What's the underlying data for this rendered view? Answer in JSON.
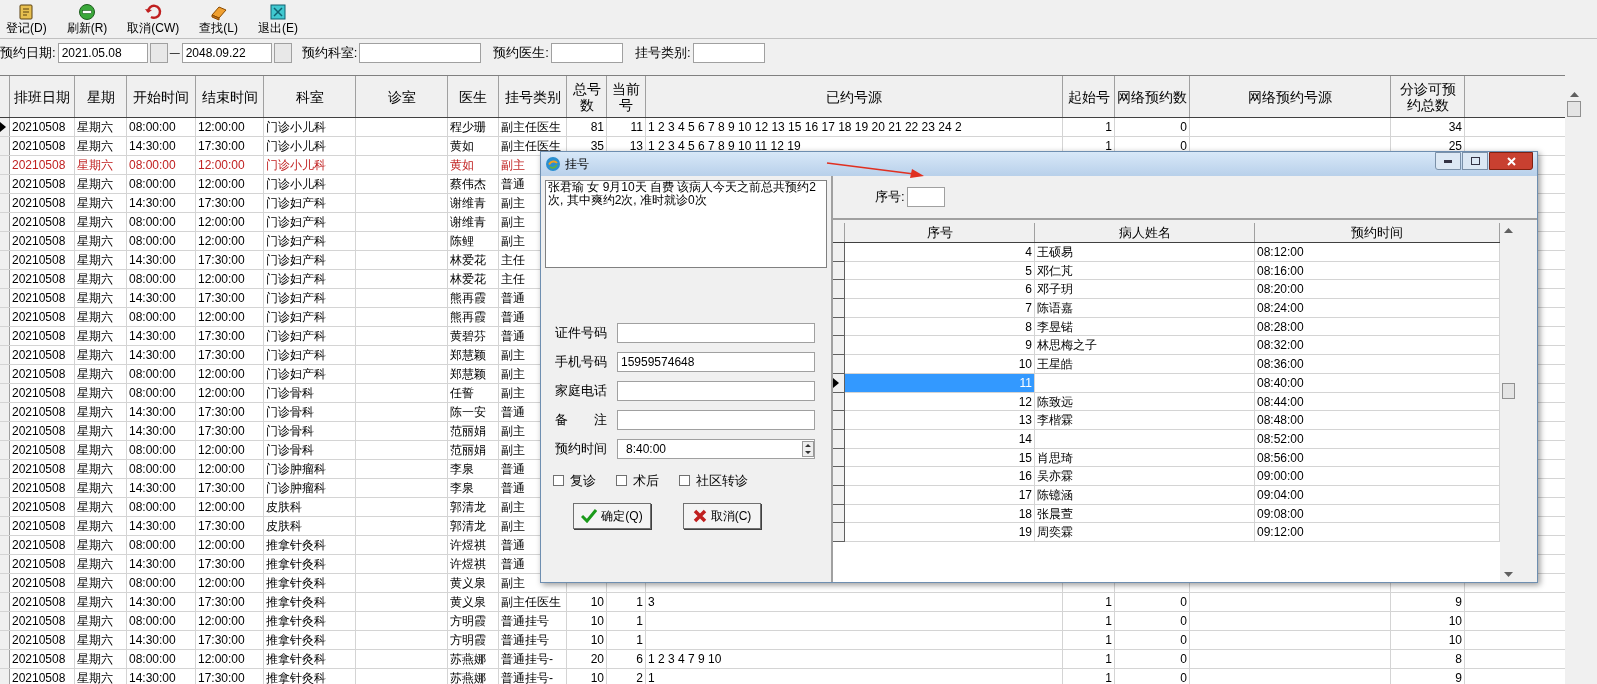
{
  "toolbar": [
    {
      "label": "登记(D)"
    },
    {
      "label": "刷新(R)"
    },
    {
      "label": "取消(CW)"
    },
    {
      "label": "查找(L)"
    },
    {
      "label": "退出(E)"
    }
  ],
  "filters": {
    "date_label": "预约日期:",
    "date_from": "2021.05.08",
    "date_sep": "—",
    "date_to": "2048.09.22",
    "dept_label": "预约科室:",
    "doctor_label": "预约医生:",
    "category_label": "挂号类别:"
  },
  "table": {
    "columns": [
      "排班日期",
      "星期",
      "开始时间",
      "结束时间",
      "科室",
      "诊室",
      "医生",
      "挂号类别",
      "总号数",
      "当前号",
      "已约号源",
      "起始号",
      "网络预约数",
      "网络预约号源",
      "分诊可预约总数"
    ],
    "rows": [
      {
        "current": true,
        "highlighted": false,
        "date": "20210508",
        "weekday": "星期六",
        "start": "08:00:00",
        "end": "12:00:00",
        "dept": "门诊小儿科",
        "doctor": "程少珊",
        "category": "副主任医生",
        "total": "81",
        "current_no": "11",
        "booked": "1 2 3 4 5 6 7 8 9 10 12 13 15 16 17 18 19 20 21 22 23 24 2",
        "start_no": "1",
        "net_count": "0",
        "triage_total": "34"
      },
      {
        "current": false,
        "highlighted": false,
        "date": "20210508",
        "weekday": "星期六",
        "start": "14:30:00",
        "end": "17:30:00",
        "dept": "门诊小儿科",
        "doctor": "黄如",
        "category": "副主任医生",
        "total": "35",
        "current_no": "13",
        "booked": "1 2 3 4 5 6 7 8 9 10 11 12 19",
        "start_no": "1",
        "net_count": "0",
        "triage_total": "25"
      },
      {
        "current": false,
        "highlighted": true,
        "date": "20210508",
        "weekday": "星期六",
        "start": "08:00:00",
        "end": "12:00:00",
        "dept": "门诊小儿科",
        "doctor": "黄如",
        "category": "副主"
      },
      {
        "current": false,
        "highlighted": false,
        "date": "20210508",
        "weekday": "星期六",
        "start": "08:00:00",
        "end": "12:00:00",
        "dept": "门诊小儿科",
        "doctor": "蔡伟杰",
        "category": "普通"
      },
      {
        "current": false,
        "highlighted": false,
        "date": "20210508",
        "weekday": "星期六",
        "start": "14:30:00",
        "end": "17:30:00",
        "dept": "门诊妇产科",
        "doctor": "谢维青",
        "category": "副主"
      },
      {
        "current": false,
        "highlighted": false,
        "date": "20210508",
        "weekday": "星期六",
        "start": "08:00:00",
        "end": "12:00:00",
        "dept": "门诊妇产科",
        "doctor": "谢维青",
        "category": "副主"
      },
      {
        "current": false,
        "highlighted": false,
        "date": "20210508",
        "weekday": "星期六",
        "start": "08:00:00",
        "end": "12:00:00",
        "dept": "门诊妇产科",
        "doctor": "陈鲤",
        "category": "副主"
      },
      {
        "current": false,
        "highlighted": false,
        "date": "20210508",
        "weekday": "星期六",
        "start": "14:30:00",
        "end": "17:30:00",
        "dept": "门诊妇产科",
        "doctor": "林爱花",
        "category": "主任"
      },
      {
        "current": false,
        "highlighted": false,
        "date": "20210508",
        "weekday": "星期六",
        "start": "08:00:00",
        "end": "12:00:00",
        "dept": "门诊妇产科",
        "doctor": "林爱花",
        "category": "主任"
      },
      {
        "current": false,
        "highlighted": false,
        "date": "20210508",
        "weekday": "星期六",
        "start": "14:30:00",
        "end": "17:30:00",
        "dept": "门诊妇产科",
        "doctor": "熊再霞",
        "category": "普通"
      },
      {
        "current": false,
        "highlighted": false,
        "date": "20210508",
        "weekday": "星期六",
        "start": "08:00:00",
        "end": "12:00:00",
        "dept": "门诊妇产科",
        "doctor": "熊再霞",
        "category": "普通"
      },
      {
        "current": false,
        "highlighted": false,
        "date": "20210508",
        "weekday": "星期六",
        "start": "14:30:00",
        "end": "17:30:00",
        "dept": "门诊妇产科",
        "doctor": "黄碧芬",
        "category": "普通"
      },
      {
        "current": false,
        "highlighted": false,
        "date": "20210508",
        "weekday": "星期六",
        "start": "14:30:00",
        "end": "17:30:00",
        "dept": "门诊妇产科",
        "doctor": "郑慧颖",
        "category": "副主"
      },
      {
        "current": false,
        "highlighted": false,
        "date": "20210508",
        "weekday": "星期六",
        "start": "08:00:00",
        "end": "12:00:00",
        "dept": "门诊妇产科",
        "doctor": "郑慧颖",
        "category": "副主"
      },
      {
        "current": false,
        "highlighted": false,
        "date": "20210508",
        "weekday": "星期六",
        "start": "08:00:00",
        "end": "12:00:00",
        "dept": "门诊骨科",
        "doctor": "任誓",
        "category": "副主"
      },
      {
        "current": false,
        "highlighted": false,
        "date": "20210508",
        "weekday": "星期六",
        "start": "14:30:00",
        "end": "17:30:00",
        "dept": "门诊骨科",
        "doctor": "陈一安",
        "category": "普通"
      },
      {
        "current": false,
        "highlighted": false,
        "date": "20210508",
        "weekday": "星期六",
        "start": "14:30:00",
        "end": "17:30:00",
        "dept": "门诊骨科",
        "doctor": "范丽娟",
        "category": "副主"
      },
      {
        "current": false,
        "highlighted": false,
        "date": "20210508",
        "weekday": "星期六",
        "start": "08:00:00",
        "end": "12:00:00",
        "dept": "门诊骨科",
        "doctor": "范丽娟",
        "category": "副主"
      },
      {
        "current": false,
        "highlighted": false,
        "date": "20210508",
        "weekday": "星期六",
        "start": "08:00:00",
        "end": "12:00:00",
        "dept": "门诊肿瘤科",
        "doctor": "李泉",
        "category": "普通"
      },
      {
        "current": false,
        "highlighted": false,
        "date": "20210508",
        "weekday": "星期六",
        "start": "14:30:00",
        "end": "17:30:00",
        "dept": "门诊肿瘤科",
        "doctor": "李泉",
        "category": "普通"
      },
      {
        "current": false,
        "highlighted": false,
        "date": "20210508",
        "weekday": "星期六",
        "start": "08:00:00",
        "end": "12:00:00",
        "dept": "皮肤科",
        "doctor": "郭清龙",
        "category": "副主"
      },
      {
        "current": false,
        "highlighted": false,
        "date": "20210508",
        "weekday": "星期六",
        "start": "14:30:00",
        "end": "17:30:00",
        "dept": "皮肤科",
        "doctor": "郭清龙",
        "category": "副主"
      },
      {
        "current": false,
        "highlighted": false,
        "date": "20210508",
        "weekday": "星期六",
        "start": "08:00:00",
        "end": "12:00:00",
        "dept": "推拿针灸科",
        "doctor": "许煜祺",
        "category": "普通"
      },
      {
        "current": false,
        "highlighted": false,
        "date": "20210508",
        "weekday": "星期六",
        "start": "14:30:00",
        "end": "17:30:00",
        "dept": "推拿针灸科",
        "doctor": "许煜祺",
        "category": "普通"
      },
      {
        "current": false,
        "highlighted": false,
        "date": "20210508",
        "weekday": "星期六",
        "start": "08:00:00",
        "end": "12:00:00",
        "dept": "推拿针灸科",
        "doctor": "黄义泉",
        "category": "副主"
      },
      {
        "current": false,
        "highlighted": false,
        "date": "20210508",
        "weekday": "星期六",
        "start": "14:30:00",
        "end": "17:30:00",
        "dept": "推拿针灸科",
        "doctor": "黄义泉",
        "category": "副主任医生",
        "total": "10",
        "current_no": "1",
        "booked": "3",
        "start_no": "1",
        "net_count": "0",
        "triage_total": "9"
      },
      {
        "current": false,
        "highlighted": false,
        "date": "20210508",
        "weekday": "星期六",
        "start": "08:00:00",
        "end": "12:00:00",
        "dept": "推拿针灸科",
        "doctor": "方明霞",
        "category": "普通挂号",
        "total": "10",
        "current_no": "1",
        "start_no": "1",
        "net_count": "0",
        "triage_total": "10"
      },
      {
        "current": false,
        "highlighted": false,
        "date": "20210508",
        "weekday": "星期六",
        "start": "14:30:00",
        "end": "17:30:00",
        "dept": "推拿针灸科",
        "doctor": "方明霞",
        "category": "普通挂号",
        "total": "10",
        "current_no": "1",
        "start_no": "1",
        "net_count": "0",
        "triage_total": "10"
      },
      {
        "current": false,
        "highlighted": false,
        "date": "20210508",
        "weekday": "星期六",
        "start": "08:00:00",
        "end": "12:00:00",
        "dept": "推拿针灸科",
        "doctor": "苏燕娜",
        "category": "普通挂号-",
        "total": "20",
        "current_no": "6",
        "booked": "1 2 3 4 7 9 10",
        "start_no": "1",
        "net_count": "0",
        "triage_total": "8"
      },
      {
        "current": false,
        "highlighted": false,
        "date": "20210508",
        "weekday": "星期六",
        "start": "14:30:00",
        "end": "17:30:00",
        "dept": "推拿针灸科",
        "doctor": "苏燕娜",
        "category": "普通挂号-",
        "total": "10",
        "current_no": "2",
        "booked": "1",
        "start_no": "1",
        "net_count": "0",
        "triage_total": "9"
      }
    ]
  },
  "dialog": {
    "title": "挂号",
    "info": "张君瑜  女   9月10天  自费  该病人今天之前总共预约2次, 其中爽约2次, 准时就诊0次",
    "fields": [
      {
        "label": "证件号码",
        "kind": "text"
      },
      {
        "label": "手机号码",
        "kind": "text",
        "value": "15959574648"
      },
      {
        "label": "家庭电话",
        "kind": "text"
      },
      {
        "label": "备　　注",
        "kind": "text"
      },
      {
        "label": "预约时间",
        "kind": "time",
        "value": "8:40:00"
      }
    ],
    "checkboxes": [
      {
        "label": "复诊",
        "checked": false
      },
      {
        "label": "术后",
        "checked": false
      },
      {
        "label": "社区转诊",
        "checked": false
      }
    ],
    "buttons": [
      {
        "label": "确定(Q)",
        "kind": "ok"
      },
      {
        "label": "取消(C)",
        "kind": "cancel"
      }
    ],
    "seq_label": "序号:",
    "grid": {
      "columns": [
        "序号",
        "病人姓名",
        "预约时间"
      ],
      "rows": [
        {
          "seq": "4",
          "name": "王硕易",
          "time": "08:12:00",
          "selected": false
        },
        {
          "seq": "5",
          "name": "邓仁芃",
          "time": "08:16:00",
          "selected": false
        },
        {
          "seq": "6",
          "name": "邓子玥",
          "time": "08:20:00",
          "selected": false
        },
        {
          "seq": "7",
          "name": "陈语嘉",
          "time": "08:24:00",
          "selected": false
        },
        {
          "seq": "8",
          "name": "李昱锘",
          "time": "08:28:00",
          "selected": false
        },
        {
          "seq": "9",
          "name": "林思梅之子",
          "time": "08:32:00",
          "selected": false
        },
        {
          "seq": "10",
          "name": "王星皓",
          "time": "08:36:00",
          "selected": false
        },
        {
          "seq": "11",
          "time": "08:40:00",
          "selected": true
        },
        {
          "seq": "12",
          "name": "陈致远",
          "time": "08:44:00",
          "selected": false
        },
        {
          "seq": "13",
          "name": "李楷霖",
          "time": "08:48:00",
          "selected": false
        },
        {
          "seq": "14",
          "time": "08:52:00",
          "selected": false
        },
        {
          "seq": "15",
          "name": "肖思琦",
          "time": "08:56:00",
          "selected": false
        },
        {
          "seq": "16",
          "name": "吴亦霖",
          "time": "09:00:00",
          "selected": false
        },
        {
          "seq": "17",
          "name": "陈镱涵",
          "time": "09:04:00",
          "selected": false
        },
        {
          "seq": "18",
          "name": "张晨萱",
          "time": "09:08:00",
          "selected": false
        },
        {
          "seq": "19",
          "name": "周奕霖",
          "time": "09:12:00",
          "selected": false
        }
      ]
    }
  }
}
